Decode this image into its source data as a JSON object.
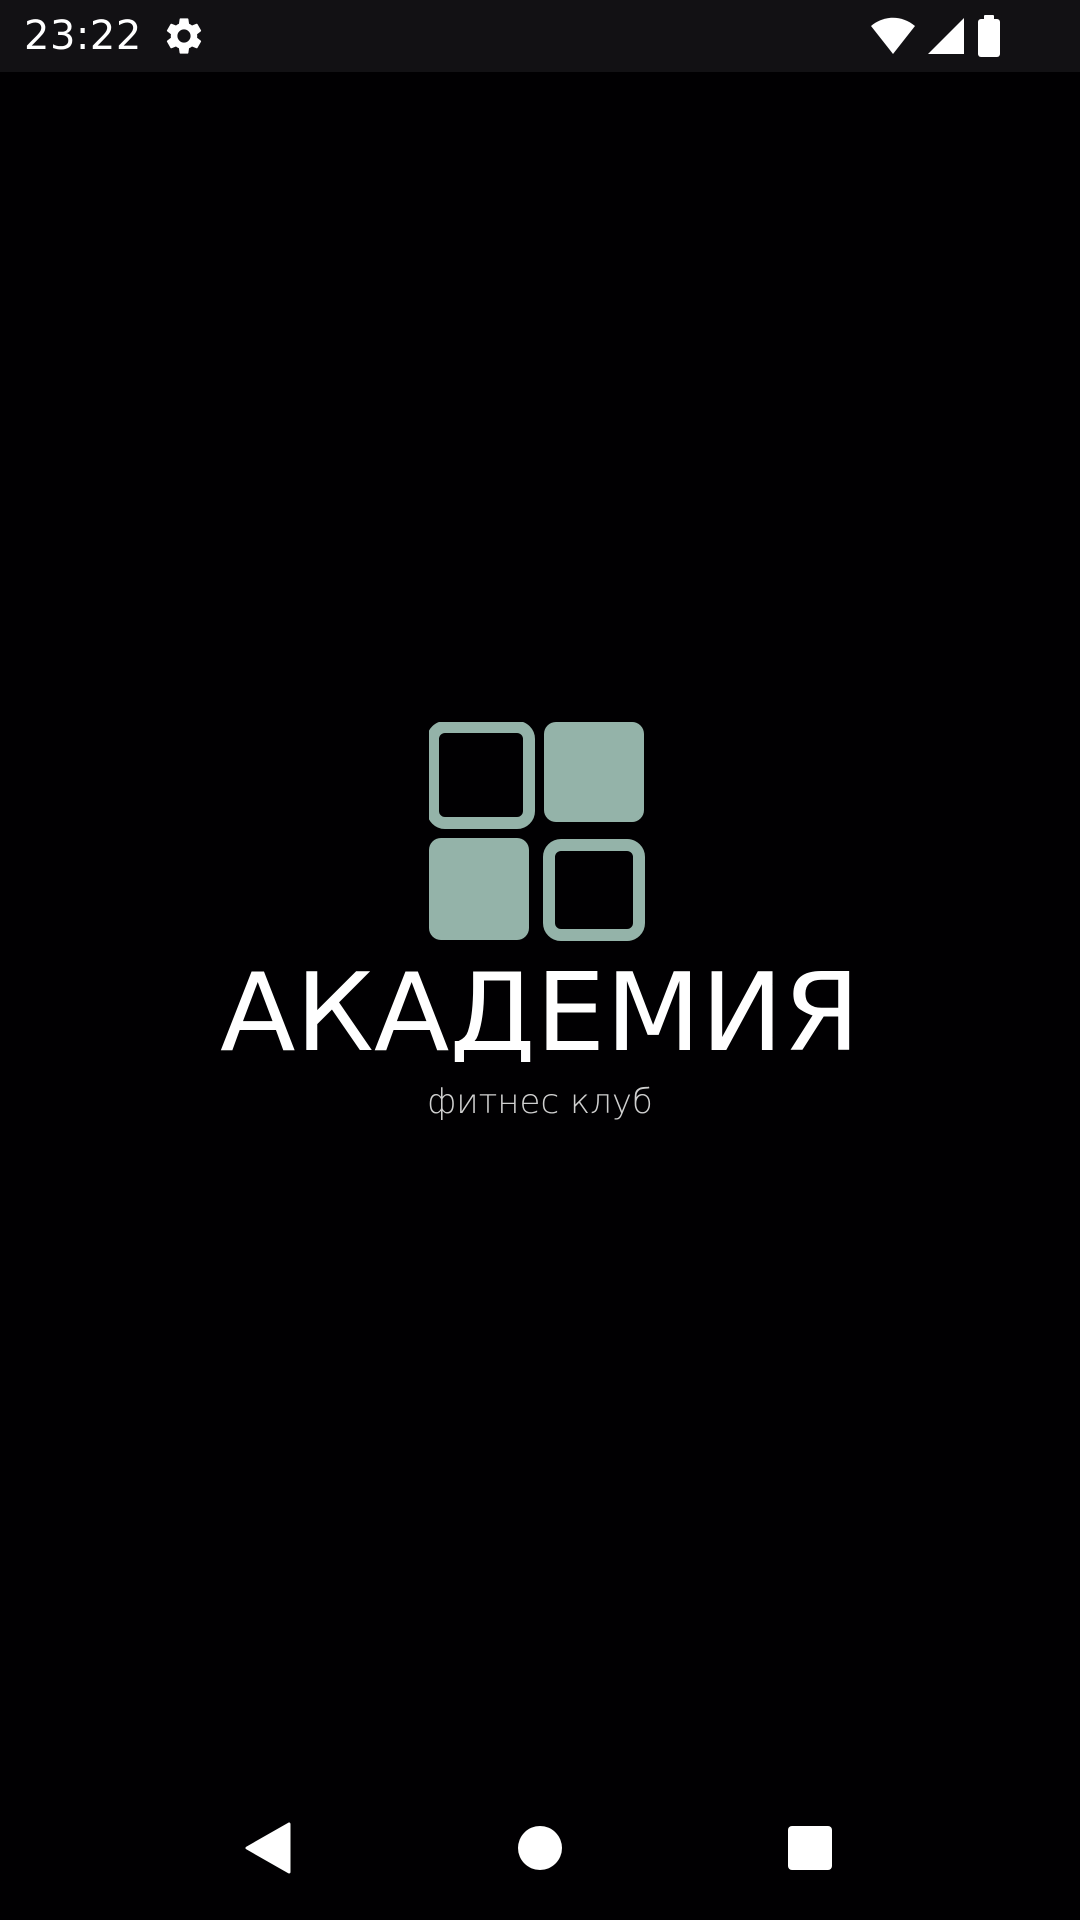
{
  "status_bar": {
    "time": "23:22",
    "icons": [
      "gear-icon",
      "wifi-icon",
      "cellular-signal-icon",
      "battery-icon"
    ],
    "background": "#121114"
  },
  "splash": {
    "brand_title": "АКАДЕМИЯ",
    "brand_subtitle": "фитнес клуб",
    "logo_color": "#94b3a9",
    "text_color": "#ffffff",
    "background": "#010002"
  },
  "nav_bar": {
    "buttons": [
      "back-icon",
      "home-icon",
      "recents-icon"
    ]
  }
}
